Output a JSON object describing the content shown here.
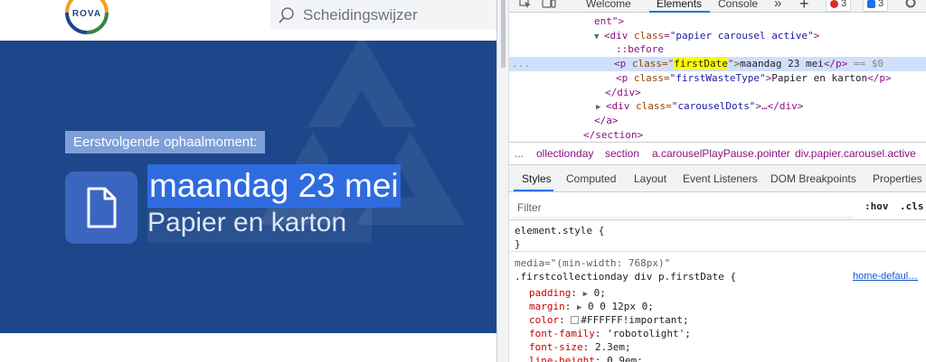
{
  "website": {
    "logo_text": "ROVA",
    "search_placeholder": "Scheidingswijzer",
    "hero": {
      "next_label": "Eerstvolgende ophaalmoment:",
      "date": "maandag 23 mei",
      "waste_type": "Papier en karton"
    }
  },
  "devtools": {
    "tabs": [
      "Welcome",
      "Elements",
      "Console"
    ],
    "active_tab": "Elements",
    "more_tabs": "»",
    "add_tab": "+",
    "errors_count": "3",
    "messages_count": "3",
    "dom": {
      "line1": "ent\">",
      "line2_tag": "<div",
      "line2_attr": "class",
      "line2_val": "\"papier carousel active\"",
      "line2_end": ">",
      "line3": "::before",
      "line4_dots": "...",
      "line4_open": "<p",
      "line4_attr": "class=\"",
      "line4_hl": "firstDate",
      "line4_close": "\">",
      "line4_text": "maandag 23 mei",
      "line4_end": "</p>",
      "line4_ref": "== $0",
      "line5_open": "<p",
      "line5_attr": "class=",
      "line5_val": "\"firstWasteType\"",
      "line5_gt": ">",
      "line5_text": "Papier en karton",
      "line5_end": "</p>",
      "line6": "</div>",
      "line7_open": "<div",
      "line7_attr": "class=",
      "line7_val": "\"carouselDots\"",
      "line7_end": ">…</div>",
      "line8": "</a>",
      "line9": "</section>"
    },
    "breadcrumbs": [
      "...",
      "ollectionday",
      "section",
      "a.carouselPlayPause.pointer",
      "div.papier.carousel.active"
    ],
    "styles_tabs": [
      "Styles",
      "Computed",
      "Layout",
      "Event Listeners",
      "DOM Breakpoints",
      "Properties"
    ],
    "filter_placeholder": "Filter",
    "hov_label": ":hov",
    "cls_label": ".cls",
    "element_style_open": "element.style {",
    "element_style_close": "}",
    "media": "media=\"(min-width: 768px)\"",
    "selector": ".firstcollectionday div p.firstDate {",
    "source_link": "home-defaul…",
    "declarations": [
      {
        "prop": "padding",
        "value": "0;"
      },
      {
        "prop": "margin",
        "value": "0 0 12px 0;"
      },
      {
        "prop": "color",
        "value": "#FFFFFF!important;"
      },
      {
        "prop": "font-family",
        "value": "'robotolight';"
      },
      {
        "prop": "font-size",
        "value": "2.3em;"
      },
      {
        "prop": "line-height",
        "value": "0.9em;"
      }
    ]
  },
  "colors": {
    "hero_bg": "#1d478a",
    "selection": "#2f6be0",
    "label_bg": "#7f9fd8",
    "tile_bg": "#3a66c0",
    "devtools_accent": "#1a73e8"
  }
}
